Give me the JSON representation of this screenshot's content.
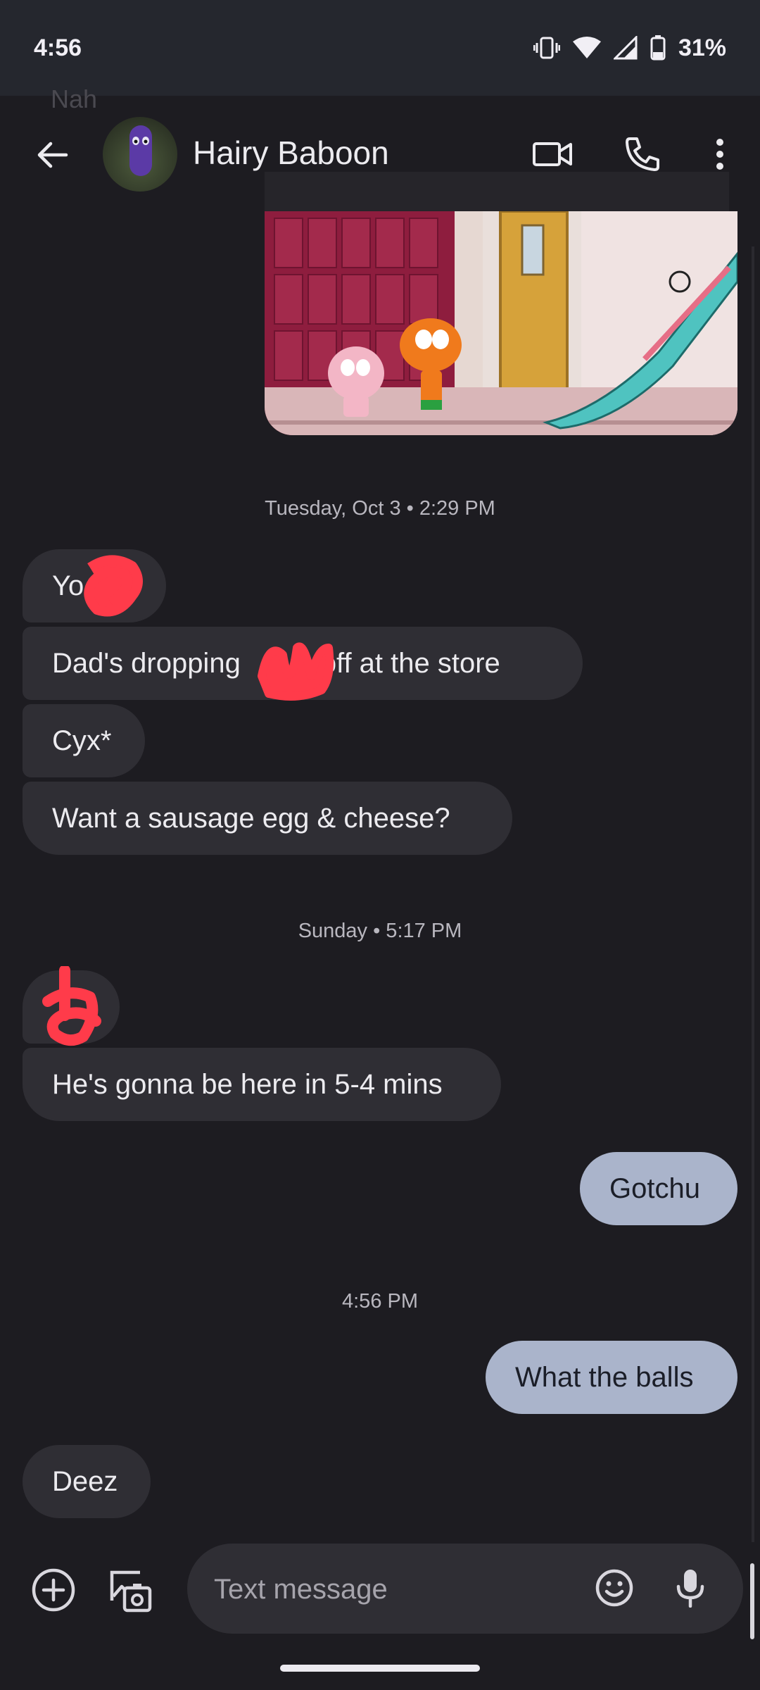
{
  "status_bar": {
    "time": "4:56",
    "battery": "31%",
    "icons": [
      "vibrate-icon",
      "wifi-icon",
      "signal-icon",
      "battery-icon"
    ]
  },
  "header": {
    "ghost_text": "Nah",
    "contact_name": "Hairy Baboon",
    "icons": [
      "back-arrow-icon",
      "video-call-icon",
      "phone-icon",
      "more-vert-icon"
    ]
  },
  "conversation": {
    "timestamps": [
      "Tuesday, Oct 3 • 2:29 PM",
      "Sunday • 5:17 PM",
      "4:56 PM"
    ],
    "messages": [
      {
        "dir": "in",
        "text": "Yo"
      },
      {
        "dir": "in",
        "text_before": "Dad's dropping",
        "text_after": "off at the store"
      },
      {
        "dir": "in",
        "text": "Cyx*"
      },
      {
        "dir": "in",
        "text": "Want a sausage egg & cheese?"
      },
      {
        "dir": "in",
        "text": ""
      },
      {
        "dir": "in",
        "text": "He's gonna be here in 5-4 mins"
      },
      {
        "dir": "out",
        "text": "Gotchu"
      },
      {
        "dir": "out",
        "text": "What the balls"
      },
      {
        "dir": "in",
        "text": "Deez"
      }
    ]
  },
  "composer": {
    "placeholder": "Text message",
    "icons": [
      "add-circle-icon",
      "gallery-icon",
      "emoji-icon",
      "mic-icon"
    ]
  },
  "colors": {
    "background": "#1d1c21",
    "incoming_bubble": "#2f2e34",
    "outgoing_bubble": "#aab4cb",
    "redaction": "#ff3b4a"
  }
}
